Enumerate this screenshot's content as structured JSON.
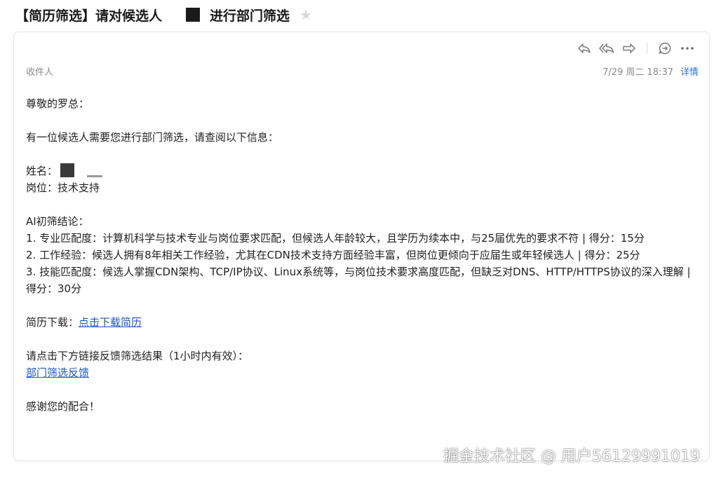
{
  "subject": {
    "prefix": "【简历筛选】请对候选人",
    "suffix": "进行部门筛选",
    "star_icon": "star-icon"
  },
  "toolbar": {
    "icons": [
      "reply-icon",
      "reply-all-icon",
      "forward-icon",
      "comment-icon",
      "more-icon"
    ]
  },
  "meta": {
    "recipient_label": "收件人",
    "date": "7/29 周二 18:37",
    "details_label": "详情"
  },
  "body": {
    "greeting": "尊敬的罗总：",
    "intro": "有一位候选人需要您进行部门筛选，请查阅以下信息：",
    "name_label": "姓名：",
    "position_line": "岗位：技术支持",
    "ai_title": "AI初筛结论：",
    "ai_points": [
      "1. 专业匹配度：计算机科学与技术专业与岗位要求匹配，但候选人年龄较大，且学历为续本中，与25届优先的要求不符 | 得分：15分",
      "2. 工作经验：候选人拥有8年相关工作经验，尤其在CDN技术支持方面经验丰富，但岗位更倾向于应届生或年轻候选人 | 得分：25分",
      "3. 技能匹配度：候选人掌握CDN架构、TCP/IP协议、Linux系统等，与岗位技术要求高度匹配，但缺乏对DNS、HTTP/HTTPS协议的深入理解 | 得分：30分"
    ],
    "download_label": "简历下载：",
    "download_link": "点击下载简历",
    "feedback_prompt": "请点击下方链接反馈筛选结果（1小时内有效）：",
    "feedback_link": "部门筛选反馈",
    "thanks": "感谢您的配合！"
  },
  "watermark": "掘金技术社区 @ 用户56129991019"
}
